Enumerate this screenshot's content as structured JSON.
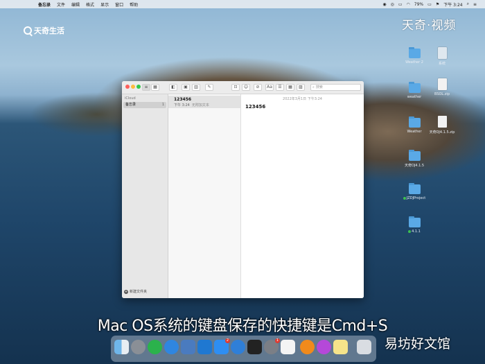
{
  "menubar": {
    "app_name": "备忘录",
    "menus": [
      "文件",
      "编辑",
      "格式",
      "显示",
      "窗口",
      "帮助"
    ],
    "battery": "79%",
    "clock": "下午 3:24"
  },
  "watermarks": {
    "left_logo": "天奇生活",
    "right_logo": "天奇·视频",
    "bottom": "易坊好文馆"
  },
  "desktop_icons": [
    {
      "label": "Weather 2"
    },
    {
      "label": "系统"
    },
    {
      "label": "weather"
    },
    {
      "label": "BSOL.zip"
    },
    {
      "label": "Weather"
    },
    {
      "label": "天奇DJ4.1.5.zip"
    },
    {
      "label": "天奇DJ4.1.5"
    },
    {
      "label": "JZDJProject"
    },
    {
      "label": "4.1.1"
    }
  ],
  "notes_app": {
    "sidebar": {
      "section": "iCloud",
      "folder_name": "备忘录",
      "folder_count": "1",
      "new_folder": "新建文件夹"
    },
    "search_placeholder": "搜索",
    "note": {
      "title": "123456",
      "time": "下午 3:24",
      "snippet": "无附加文本",
      "date_header": "2022年3月1日 下午3:24",
      "body": "123456"
    }
  },
  "caption": "Mac OS系统的键盘保存的快捷键是Cmd+S",
  "dock_icons": [
    "finder-icon",
    "launchpad-icon",
    "wechat-icon",
    "safari-icon",
    "xcode-icon",
    "files-icon",
    "appstore-icon",
    "upload-icon",
    "terminal-icon",
    "system-preferences-icon",
    "qq-icon",
    "firefox-icon",
    "firefox-dev-icon",
    "notes-icon",
    "trash-icon"
  ]
}
